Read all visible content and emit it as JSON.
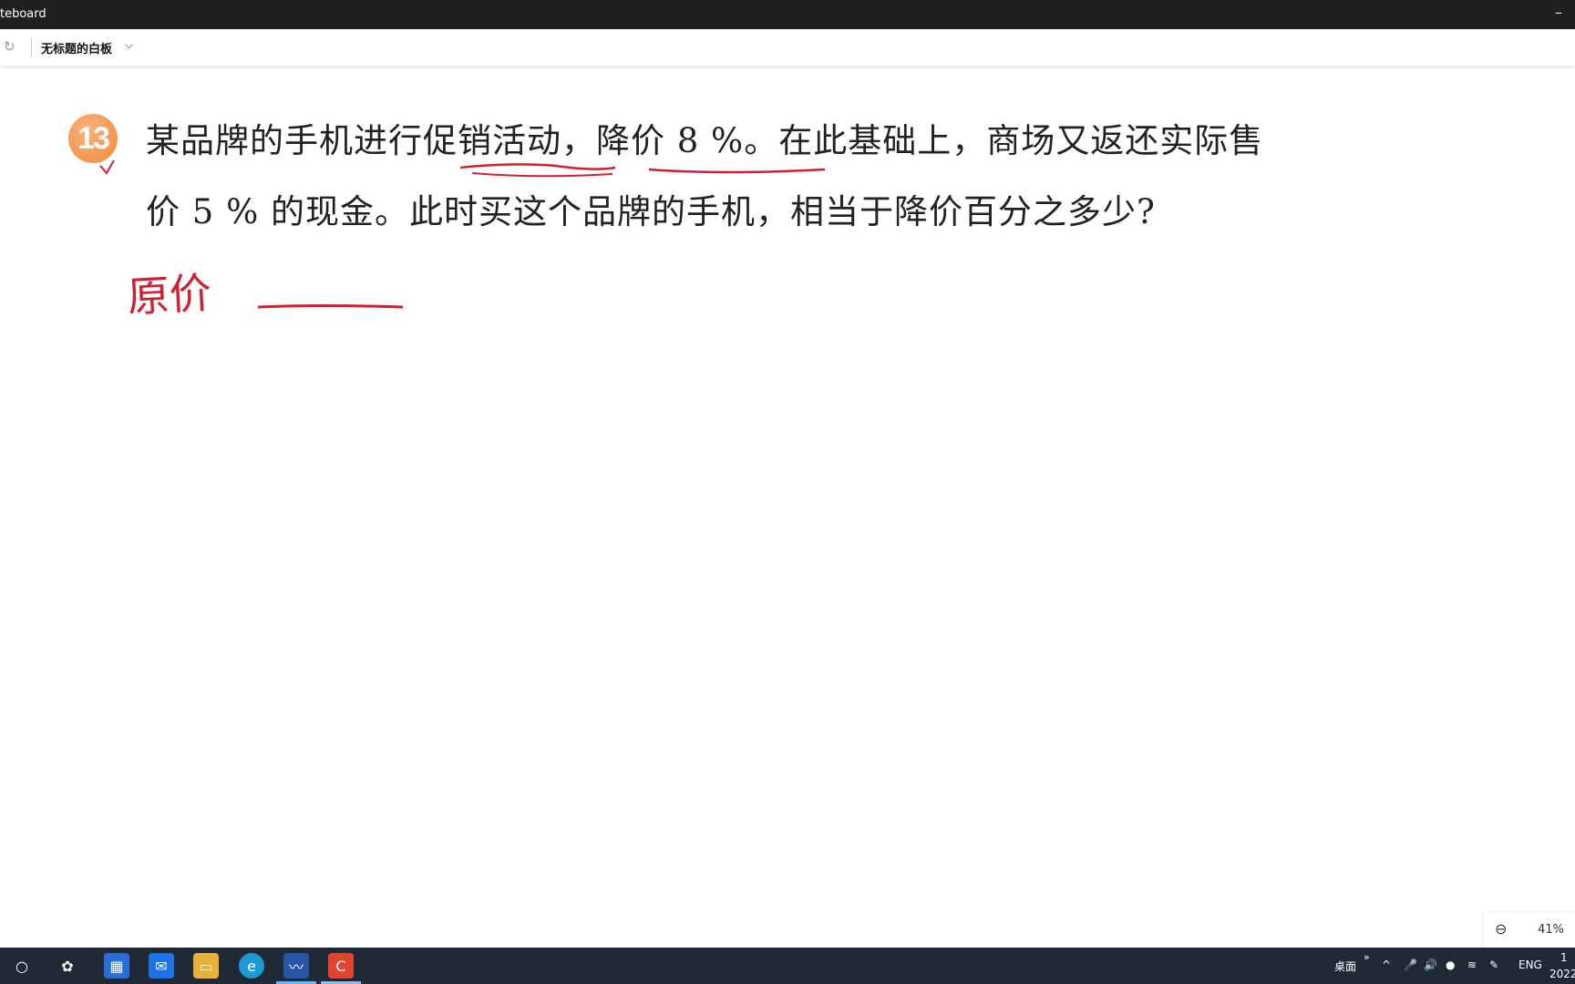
{
  "window": {
    "title": "teboard",
    "minimize_glyph": "–"
  },
  "toolbar": {
    "board_title": "无标题的白板",
    "redo_icon": "redo-icon",
    "dropdown_icon": "chevron-down-icon"
  },
  "problem": {
    "number": "13",
    "line1": "某品牌的手机进行促销活动，降价 8 %。在此基础上，商场又返还实际售",
    "line2": "价 5 % 的现金。此时买这个品牌的手机，相当于降价百分之多少?"
  },
  "handwriting": {
    "label": "原价",
    "ink_color": "#d32030"
  },
  "zoom": {
    "level": "41%"
  },
  "taskbar": {
    "desktop_label": "桌面",
    "overflow_glyph": "»",
    "language": "ENG",
    "clock_top": "1",
    "clock_bottom": "2022"
  },
  "colors": {
    "accent": "#f08a3c",
    "ink": "#d32030",
    "taskbar": "#1f2a36"
  }
}
